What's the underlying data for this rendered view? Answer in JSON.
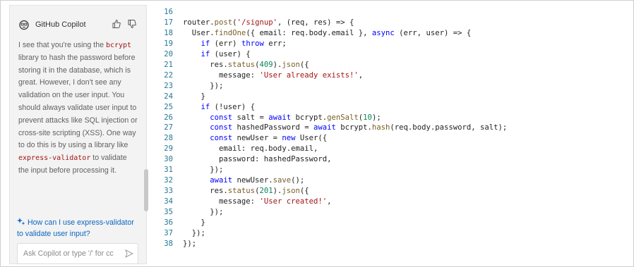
{
  "copilot": {
    "title": "GitHub Copilot",
    "message_parts": [
      {
        "text": "I see that you're using the ",
        "code": false
      },
      {
        "text": "bcrypt",
        "code": true
      },
      {
        "text": " library to hash the password before storing it in the database, which is great. However, I don't see any validation on the user input. You should always validate user input to prevent attacks like SQL injection or cross-site scripting (XSS). One way to do this is by using a library like ",
        "code": false
      },
      {
        "text": "express-validator",
        "code": true
      },
      {
        "text": " to validate the input before processing it.",
        "code": false
      }
    ],
    "suggestion": "How can I use express-validator to validate user input?",
    "input_placeholder": "Ask Copilot or type '/' for cc",
    "icons": {
      "logo": "copilot-logo-icon",
      "thumbs_up": "thumbs-up-icon",
      "thumbs_down": "thumbs-down-icon",
      "sparkle": "sparkle-icon",
      "send": "send-icon"
    }
  },
  "editor": {
    "lines": [
      {
        "num": "16",
        "tokens": [
          {
            "t": "",
            "c": ""
          }
        ]
      },
      {
        "num": "17",
        "tokens": [
          {
            "t": "router.",
            "c": ""
          },
          {
            "t": "post",
            "c": "f"
          },
          {
            "t": "(",
            "c": ""
          },
          {
            "t": "'/signup'",
            "c": "s"
          },
          {
            "t": ", (req, res) => {",
            "c": ""
          }
        ]
      },
      {
        "num": "18",
        "tokens": [
          {
            "t": "  User.",
            "c": ""
          },
          {
            "t": "findOne",
            "c": "f"
          },
          {
            "t": "({ email: req.body.email }, ",
            "c": ""
          },
          {
            "t": "async",
            "c": "k"
          },
          {
            "t": " (err, user) => {",
            "c": ""
          }
        ]
      },
      {
        "num": "19",
        "tokens": [
          {
            "t": "    ",
            "c": ""
          },
          {
            "t": "if",
            "c": "k"
          },
          {
            "t": " (err) ",
            "c": ""
          },
          {
            "t": "throw",
            "c": "k"
          },
          {
            "t": " err;",
            "c": ""
          }
        ]
      },
      {
        "num": "20",
        "tokens": [
          {
            "t": "    ",
            "c": ""
          },
          {
            "t": "if",
            "c": "k"
          },
          {
            "t": " (user) {",
            "c": ""
          }
        ]
      },
      {
        "num": "21",
        "tokens": [
          {
            "t": "      res.",
            "c": ""
          },
          {
            "t": "status",
            "c": "f"
          },
          {
            "t": "(",
            "c": ""
          },
          {
            "t": "409",
            "c": "n"
          },
          {
            "t": ").",
            "c": ""
          },
          {
            "t": "json",
            "c": "f"
          },
          {
            "t": "({",
            "c": ""
          }
        ]
      },
      {
        "num": "22",
        "tokens": [
          {
            "t": "        message: ",
            "c": ""
          },
          {
            "t": "'User already exists!'",
            "c": "s"
          },
          {
            "t": ",",
            "c": ""
          }
        ]
      },
      {
        "num": "23",
        "tokens": [
          {
            "t": "      });",
            "c": ""
          }
        ]
      },
      {
        "num": "24",
        "tokens": [
          {
            "t": "    }",
            "c": ""
          }
        ]
      },
      {
        "num": "25",
        "tokens": [
          {
            "t": "    ",
            "c": ""
          },
          {
            "t": "if",
            "c": "k"
          },
          {
            "t": " (!user) {",
            "c": ""
          }
        ]
      },
      {
        "num": "26",
        "tokens": [
          {
            "t": "      ",
            "c": ""
          },
          {
            "t": "const",
            "c": "k"
          },
          {
            "t": " salt = ",
            "c": ""
          },
          {
            "t": "await",
            "c": "k"
          },
          {
            "t": " bcrypt.",
            "c": ""
          },
          {
            "t": "genSalt",
            "c": "f"
          },
          {
            "t": "(",
            "c": ""
          },
          {
            "t": "10",
            "c": "n"
          },
          {
            "t": ");",
            "c": ""
          }
        ]
      },
      {
        "num": "27",
        "tokens": [
          {
            "t": "      ",
            "c": ""
          },
          {
            "t": "const",
            "c": "k"
          },
          {
            "t": " hashedPassword = ",
            "c": ""
          },
          {
            "t": "await",
            "c": "k"
          },
          {
            "t": " bcrypt.",
            "c": ""
          },
          {
            "t": "hash",
            "c": "f"
          },
          {
            "t": "(req.body.password, salt);",
            "c": ""
          }
        ]
      },
      {
        "num": "28",
        "tokens": [
          {
            "t": "      ",
            "c": ""
          },
          {
            "t": "const",
            "c": "k"
          },
          {
            "t": " newUser = ",
            "c": ""
          },
          {
            "t": "new",
            "c": "k"
          },
          {
            "t": " User({",
            "c": ""
          }
        ]
      },
      {
        "num": "29",
        "tokens": [
          {
            "t": "        email: req.body.email,",
            "c": ""
          }
        ]
      },
      {
        "num": "30",
        "tokens": [
          {
            "t": "        password: hashedPassword,",
            "c": ""
          }
        ]
      },
      {
        "num": "31",
        "tokens": [
          {
            "t": "      });",
            "c": ""
          }
        ]
      },
      {
        "num": "32",
        "tokens": [
          {
            "t": "      ",
            "c": ""
          },
          {
            "t": "await",
            "c": "k"
          },
          {
            "t": " newUser.",
            "c": ""
          },
          {
            "t": "save",
            "c": "f"
          },
          {
            "t": "();",
            "c": ""
          }
        ]
      },
      {
        "num": "33",
        "tokens": [
          {
            "t": "      res.",
            "c": ""
          },
          {
            "t": "status",
            "c": "f"
          },
          {
            "t": "(",
            "c": ""
          },
          {
            "t": "201",
            "c": "n"
          },
          {
            "t": ").",
            "c": ""
          },
          {
            "t": "json",
            "c": "f"
          },
          {
            "t": "({",
            "c": ""
          }
        ]
      },
      {
        "num": "34",
        "tokens": [
          {
            "t": "        message: ",
            "c": ""
          },
          {
            "t": "'User created!'",
            "c": "s"
          },
          {
            "t": ",",
            "c": ""
          }
        ]
      },
      {
        "num": "35",
        "tokens": [
          {
            "t": "      });",
            "c": ""
          }
        ]
      },
      {
        "num": "36",
        "tokens": [
          {
            "t": "    }",
            "c": ""
          }
        ]
      },
      {
        "num": "37",
        "tokens": [
          {
            "t": "  });",
            "c": ""
          }
        ]
      },
      {
        "num": "38",
        "tokens": [
          {
            "t": "});",
            "c": ""
          }
        ]
      }
    ]
  }
}
